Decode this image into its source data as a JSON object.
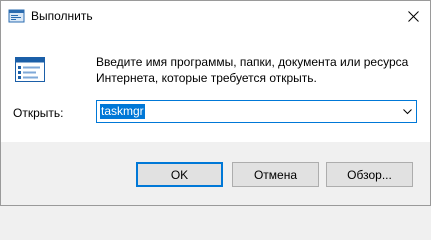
{
  "window": {
    "title": "Выполнить"
  },
  "content": {
    "description": "Введите имя программы, папки, документа или ресурса Интернета, которые требуется открыть.",
    "open_label": "Открыть:",
    "combo_value": "taskmgr"
  },
  "buttons": {
    "ok": "OK",
    "cancel": "Отмена",
    "browse": "Обзор..."
  },
  "icons": {
    "app": "run-dialog-icon",
    "run": "run-program-icon",
    "close": "close-icon",
    "dropdown": "chevron-down-icon"
  },
  "colors": {
    "accent": "#0078d7",
    "selection_text": "#ffffff",
    "footer_bg": "#f0f0f0",
    "button_bg": "#e1e1e1"
  }
}
